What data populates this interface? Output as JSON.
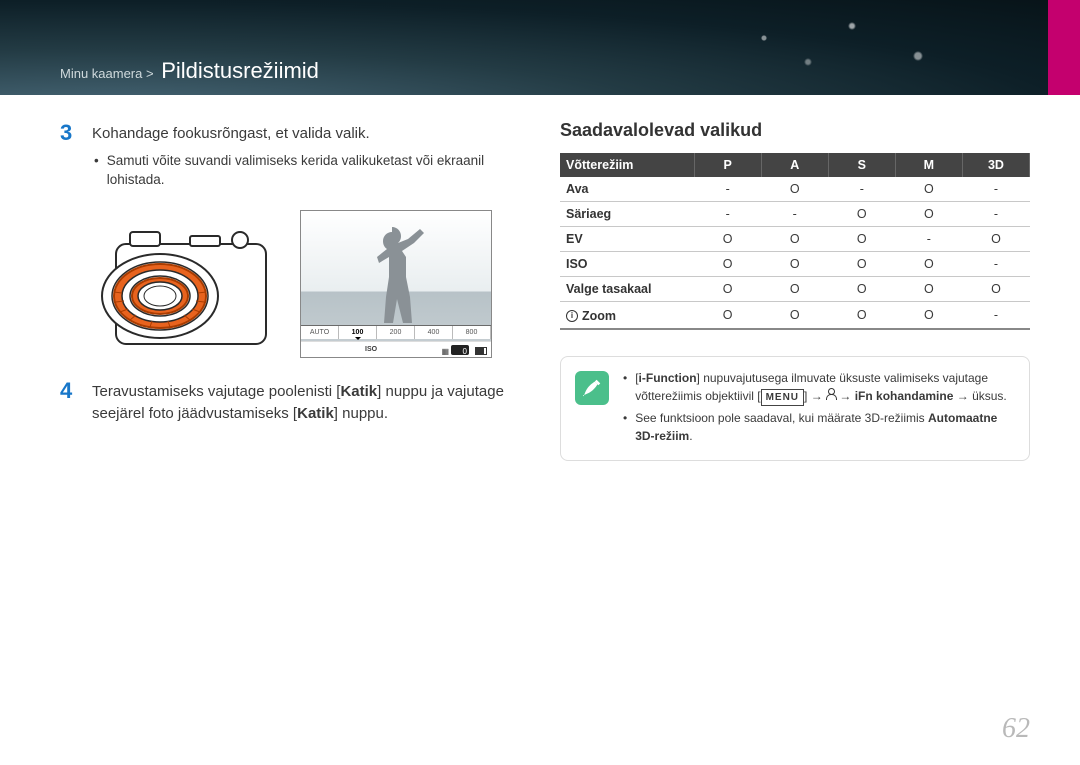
{
  "breadcrumb": {
    "prefix": "Minu kaamera >",
    "page": "Pildistusrežiimid"
  },
  "step3": {
    "num": "3",
    "text": "Kohandage fookusrõngast, et valida valik.",
    "bullet": "Samuti võite suvandi valimiseks kerida valikuketast või ekraanil lohistada."
  },
  "step4": {
    "num": "4",
    "text_before": "Teravustamiseks vajutage poolenisti [",
    "katik1": "Katik",
    "text_mid": "] nuppu ja vajutage seejärel foto jäädvustamiseks [",
    "katik2": "Katik",
    "text_after": "] nuppu."
  },
  "lcd": {
    "iso_cells": [
      "AUTO",
      "100",
      "200",
      "400",
      "800"
    ],
    "iso_selected_index": 1,
    "iso_label": "ISO",
    "ev_label": "0"
  },
  "options": {
    "title": "Saadavalolevad valikud",
    "headers": [
      "Võtterežiim",
      "P",
      "A",
      "S",
      "M",
      "3D"
    ],
    "rows": [
      {
        "label": "Ava",
        "cells": [
          "-",
          "O",
          "-",
          "O",
          "-"
        ]
      },
      {
        "label": "Säriaeg",
        "cells": [
          "-",
          "-",
          "O",
          "O",
          "-"
        ]
      },
      {
        "label": "EV",
        "cells": [
          "O",
          "O",
          "O",
          "-",
          "O"
        ]
      },
      {
        "label": "ISO",
        "cells": [
          "O",
          "O",
          "O",
          "O",
          "-"
        ]
      },
      {
        "label": "Valge tasakaal",
        "cells": [
          "O",
          "O",
          "O",
          "O",
          "O"
        ]
      }
    ],
    "zoom_row": {
      "label": "Zoom",
      "cells": [
        "O",
        "O",
        "O",
        "O",
        "-"
      ]
    }
  },
  "note": {
    "line1a": "[",
    "line1b": "i-Function",
    "line1c": "] nupuvajutusega ilmuvate üksuste valimiseks vajutage võtterežiimis objektiivil [",
    "menu": "MENU",
    "line1d": "] → ",
    "line1e": " → ",
    "line1f": "iFn kohandamine",
    "line1g": " → üksus.",
    "line2a": "See funktsioon pole saadaval, kui määrate 3D-režiimis ",
    "line2b": "Automaatne 3D-režiim",
    "line2c": "."
  },
  "page_number": "62"
}
